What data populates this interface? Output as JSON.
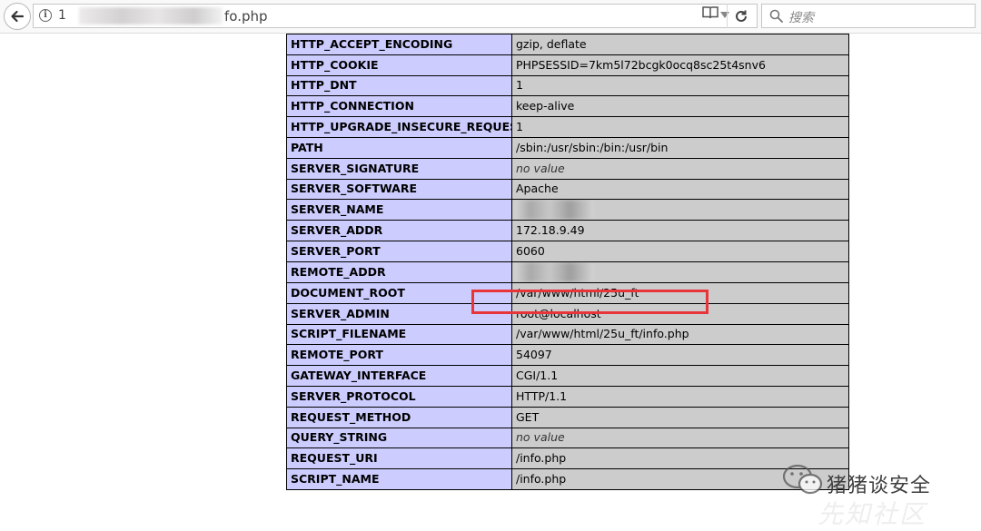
{
  "browser": {
    "url_visible_suffix": "fo.php",
    "url_prefix_char": "1",
    "search_placeholder": "搜索"
  },
  "table": {
    "rows": [
      {
        "key": "HTTP_ACCEPT_ENCODING",
        "value": "gzip, deflate"
      },
      {
        "key": "HTTP_COOKIE",
        "value": "PHPSESSID=7km5l72bcgk0ocq8sc25t4snv6"
      },
      {
        "key": "HTTP_DNT",
        "value": "1"
      },
      {
        "key": "HTTP_CONNECTION",
        "value": "keep-alive"
      },
      {
        "key": "HTTP_UPGRADE_INSECURE_REQUESTS",
        "value": "1"
      },
      {
        "key": "PATH",
        "value": "/sbin:/usr/sbin:/bin:/usr/bin"
      },
      {
        "key": "SERVER_SIGNATURE",
        "value": "no value"
      },
      {
        "key": "SERVER_SOFTWARE",
        "value": "Apache"
      },
      {
        "key": "SERVER_NAME",
        "value": ""
      },
      {
        "key": "SERVER_ADDR",
        "value": "172.18.9.49"
      },
      {
        "key": "SERVER_PORT",
        "value": "6060"
      },
      {
        "key": "REMOTE_ADDR",
        "value": ""
      },
      {
        "key": "DOCUMENT_ROOT",
        "value": "/var/www/html/25u_ft"
      },
      {
        "key": "SERVER_ADMIN",
        "value": "root@localhost"
      },
      {
        "key": "SCRIPT_FILENAME",
        "value": "/var/www/html/25u_ft/info.php"
      },
      {
        "key": "REMOTE_PORT",
        "value": "54097"
      },
      {
        "key": "GATEWAY_INTERFACE",
        "value": "CGI/1.1"
      },
      {
        "key": "SERVER_PROTOCOL",
        "value": "HTTP/1.1"
      },
      {
        "key": "REQUEST_METHOD",
        "value": "GET"
      },
      {
        "key": "QUERY_STRING",
        "value": "no value"
      },
      {
        "key": "REQUEST_URI",
        "value": "/info.php"
      },
      {
        "key": "SCRIPT_NAME",
        "value": "/info.php"
      }
    ]
  },
  "watermark": {
    "text": "猪猪谈安全",
    "faint_text": "先知社区"
  },
  "colors": {
    "key_cell": "#ccccff",
    "value_cell": "#cccccc",
    "highlight": "#e8353a"
  }
}
